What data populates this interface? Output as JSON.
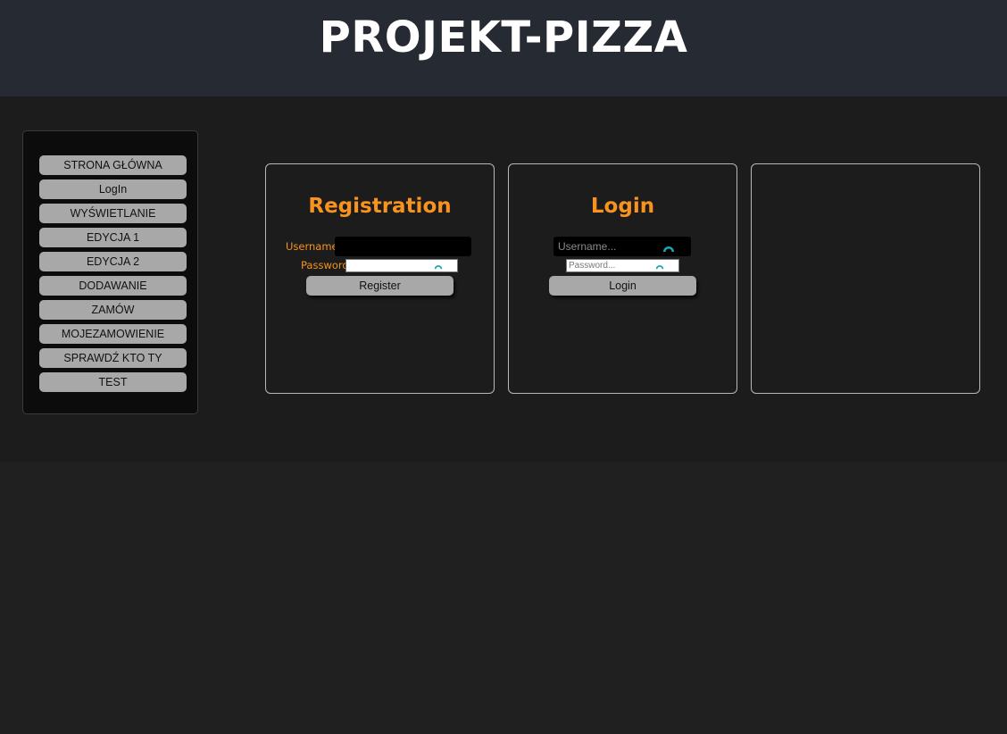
{
  "header": {
    "title": "PROJEKT-PIZZA"
  },
  "sidebar": {
    "items": [
      {
        "label": "STRONA GŁÓWNA"
      },
      {
        "label": "LogIn"
      },
      {
        "label": "WYŚWIETLANIE"
      },
      {
        "label": "EDYCJA 1"
      },
      {
        "label": "EDYCJA 2"
      },
      {
        "label": "DODAWANIE"
      },
      {
        "label": "ZAMÓW"
      },
      {
        "label": "MOJEZAMOWIENIE"
      },
      {
        "label": "SPRAWDŹ KTO TY"
      },
      {
        "label": "TEST"
      }
    ]
  },
  "registration": {
    "title": "Registration",
    "username_label": "Username",
    "username_value": "",
    "password_label": "Password",
    "password_value": "",
    "button_label": "Register"
  },
  "login": {
    "title": "Login",
    "username_placeholder": "Username...",
    "password_placeholder": "Password...",
    "button_label": "Login"
  },
  "colors": {
    "accent": "#f7931e",
    "header_bg": "#262a33",
    "page_bg": "#202020",
    "panel_border": "#b9b9b9",
    "button_bg": "#a8a8a8",
    "icon_teal": "#1ba8b0"
  },
  "icons": {
    "password_manager": "key-icon"
  }
}
